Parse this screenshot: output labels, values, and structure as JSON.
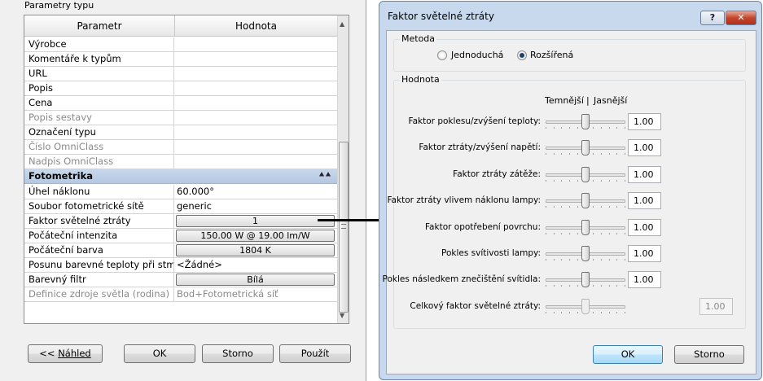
{
  "left": {
    "title": "Parametry typu",
    "columns": [
      "Parametr",
      "Hodnota"
    ],
    "rows": [
      {
        "name": "Výrobce",
        "value": ""
      },
      {
        "name": "Komentáře k typům",
        "value": ""
      },
      {
        "name": "URL",
        "value": ""
      },
      {
        "name": "Popis",
        "value": ""
      },
      {
        "name": "Cena",
        "value": ""
      },
      {
        "name": "Popis sestavy",
        "value": ""
      },
      {
        "name": "Označení typu",
        "value": ""
      },
      {
        "name": "Číslo OmniClass",
        "value": ""
      },
      {
        "name": "Nadpis OmniClass",
        "value": ""
      }
    ],
    "group": {
      "label": "Fotometrika",
      "icon": "collapse-up-icon"
    },
    "photometric_rows": [
      {
        "name": "Úhel náklonu",
        "value": "60.000°"
      },
      {
        "name": "Soubor fotometrické sítě",
        "value": "generic"
      },
      {
        "name": "Faktor světelné ztráty",
        "value": "1"
      },
      {
        "name": "Počáteční intenzita",
        "value": "150.00 W @ 19.00 lm/W"
      },
      {
        "name": "Počáteční barva",
        "value": "1804 K"
      },
      {
        "name": "Posunu barevné teploty při stmív",
        "value": "<Žádné>"
      },
      {
        "name": "Barevný filtr",
        "value": "Bílá"
      },
      {
        "name": "Definice zdroje světla (rodina)",
        "value": "Bod+Fotometrická síť"
      }
    ],
    "buttons": {
      "preview_prefix": "<< ",
      "preview": "Náhled",
      "ok": "OK",
      "cancel": "Storno",
      "apply": "Použít"
    }
  },
  "dialog": {
    "title": "Faktor světelné ztráty",
    "help": "?",
    "method": {
      "label": "Metoda",
      "options": [
        "Jednoduchá",
        "Rozšířená"
      ],
      "selected": "Rozšířená"
    },
    "value": {
      "label": "Hodnota",
      "darker": "Temnější",
      "separator": "|",
      "lighter": "Jasnější",
      "factors": [
        {
          "label": "Faktor poklesu/zvýšení teploty:",
          "value": "1.00",
          "position": 0.5
        },
        {
          "label": "Faktor ztráty/zvýšení napětí:",
          "value": "1.00",
          "position": 0.5
        },
        {
          "label": "Faktor ztráty zátěže:",
          "value": "1.00",
          "position": 0.5
        },
        {
          "label": "Faktor ztráty vlivem náklonu lampy:",
          "value": "1.00",
          "position": 0.5
        },
        {
          "label": "Faktor opotřebení povrchu:",
          "value": "1.00",
          "position": 0.5
        },
        {
          "label": "Pokles svítivosti lampy:",
          "value": "1.00",
          "position": 0.5
        },
        {
          "label": "Pokles následkem znečištění svítidla:",
          "value": "1.00",
          "position": 0.5
        }
      ],
      "total": {
        "label": "Celkový faktor světelné ztráty:",
        "value": "1.00",
        "position": 0.5
      }
    },
    "buttons": {
      "ok": "OK",
      "cancel": "Storno"
    }
  }
}
